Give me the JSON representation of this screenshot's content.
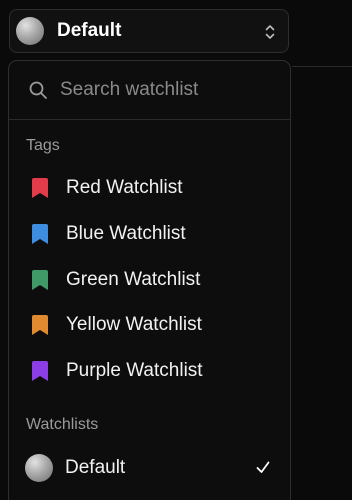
{
  "selector": {
    "label": "Default"
  },
  "search": {
    "placeholder": "Search watchlist",
    "value": ""
  },
  "tags": {
    "header": "Tags",
    "items": [
      {
        "label": "Red Watchlist",
        "color": "#e23b4a",
        "icon": "bookmark-icon"
      },
      {
        "label": "Blue Watchlist",
        "color": "#3d8ee0",
        "icon": "bookmark-icon"
      },
      {
        "label": "Green Watchlist",
        "color": "#3f9a68",
        "icon": "bookmark-icon"
      },
      {
        "label": "Yellow Watchlist",
        "color": "#e18a30",
        "icon": "bookmark-icon"
      },
      {
        "label": "Purple Watchlist",
        "color": "#8b3ee6",
        "icon": "bookmark-icon"
      }
    ]
  },
  "watchlists": {
    "header": "Watchlists",
    "items": [
      {
        "label": "Default",
        "selected": true,
        "icon": "avatar"
      }
    ]
  },
  "colors": {
    "background": "#0a0a0a",
    "panel": "#0d0d0d",
    "border": "#2f2f2f",
    "muted_text": "#9a9a9a"
  }
}
